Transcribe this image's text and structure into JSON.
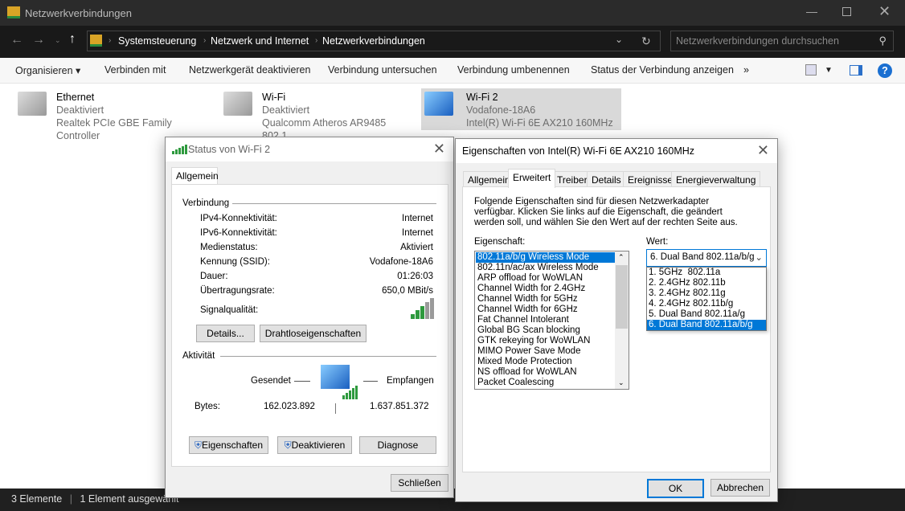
{
  "window": {
    "title": "Netzwerkverbindungen"
  },
  "address": {
    "crumbs": [
      "Systemsteuerung",
      "Netzwerk und Internet",
      "Netzwerkverbindungen"
    ],
    "search_placeholder": "Netzwerkverbindungen durchsuchen"
  },
  "toolbar": {
    "items": [
      "Organisieren",
      "Verbinden mit",
      "Netzwerkgerät deaktivieren",
      "Verbindung untersuchen",
      "Verbindung umbenennen",
      "Status der Verbindung anzeigen"
    ],
    "more": "»"
  },
  "connections": [
    {
      "name": "Ethernet",
      "status": "Deaktiviert",
      "device": "Realtek PCIe GBE Family Controller"
    },
    {
      "name": "Wi-Fi",
      "status": "Deaktiviert",
      "device": "Qualcomm Atheros AR9485 802.1..."
    },
    {
      "name": "Wi-Fi 2",
      "status": "Vodafone-18A6",
      "device": "Intel(R) Wi-Fi 6E AX210 160MHz"
    }
  ],
  "statusbar": {
    "count": "3 Elemente",
    "selected": "1 Element ausgewählt"
  },
  "status_dialog": {
    "title": "Status von Wi-Fi 2",
    "tab": "Allgemein",
    "connection_heading": "Verbindung",
    "rows": [
      {
        "label": "IPv4-Konnektivität:",
        "value": "Internet"
      },
      {
        "label": "IPv6-Konnektivität:",
        "value": "Internet"
      },
      {
        "label": "Medienstatus:",
        "value": "Aktiviert"
      },
      {
        "label": "Kennung (SSID):",
        "value": "Vodafone-18A6"
      },
      {
        "label": "Dauer:",
        "value": "01:26:03"
      },
      {
        "label": "Übertragungsrate:",
        "value": "650,0 MBit/s"
      }
    ],
    "signal_label": "Signalqualität:",
    "signal_bars": 3,
    "signal_max": 5,
    "details_btn": "Details...",
    "wireless_btn": "Drahtloseigenschaften",
    "activity_heading": "Aktivität",
    "sent_label": "Gesendet",
    "received_label": "Empfangen",
    "bytes_label": "Bytes:",
    "bytes_sent": "162.023.892",
    "bytes_received": "1.637.851.372",
    "properties_btn": "Eigenschaften",
    "disable_btn": "Deaktivieren",
    "diagnose_btn": "Diagnose",
    "close_btn": "Schließen"
  },
  "props_dialog": {
    "title": "Eigenschaften von Intel(R) Wi-Fi 6E AX210 160MHz",
    "tabs": [
      "Allgemein",
      "Erweitert",
      "Treiber",
      "Details",
      "Ereignisse",
      "Energieverwaltung"
    ],
    "description": "Folgende Eigenschaften sind für diesen Netzwerkadapter verfügbar. Klicken Sie links auf die Eigenschaft, die geändert werden soll, und wählen Sie den Wert auf der rechten Seite aus.",
    "property_label": "Eigenschaft:",
    "value_label": "Wert:",
    "properties": [
      "802.11a/b/g Wireless Mode",
      "802.11n/ac/ax Wireless Mode",
      "ARP offload for WoWLAN",
      "Channel Width for 2.4GHz",
      "Channel Width for 5GHz",
      "Channel Width for 6GHz",
      "Fat Channel Intolerant",
      "Global BG Scan blocking",
      "GTK rekeying for WoWLAN",
      "MIMO Power Save Mode",
      "Mixed Mode Protection",
      "NS offload for WoWLAN",
      "Packet Coalescing"
    ],
    "selected_value": "6. Dual Band 802.11a/b/g",
    "options": [
      "1. 5GHz  802.11a",
      "2. 2.4GHz 802.11b",
      "3. 2.4GHz 802.11g",
      "4. 2.4GHz 802.11b/g",
      "5. Dual Band 802.11a/g",
      "6. Dual Band 802.11a/b/g"
    ],
    "ok": "OK",
    "cancel": "Abbrechen"
  }
}
